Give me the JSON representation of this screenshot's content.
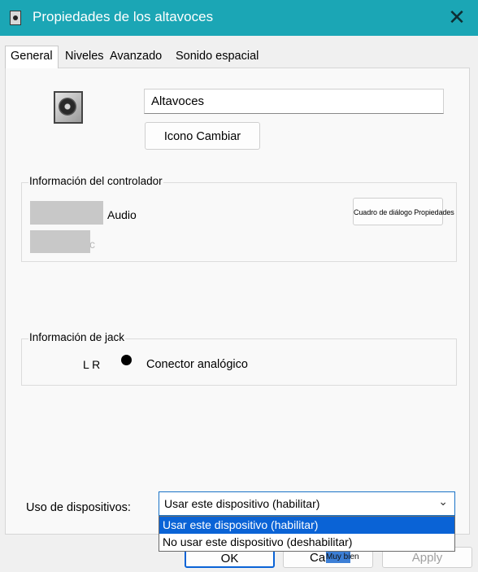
{
  "window": {
    "title": "Propiedades de los altavoces",
    "close_glyph": "✕"
  },
  "tabs": [
    {
      "label": "General",
      "active": true
    },
    {
      "label": "Niveles",
      "active": false
    },
    {
      "label": "Avanzado",
      "active": false
    },
    {
      "label": "Sonido espacial",
      "active": false
    }
  ],
  "general": {
    "device_name": "Altavoces",
    "change_icon_label": "Icono Cambiar",
    "driver_group": {
      "title": "Información del controlador",
      "driver_line1": "Audio",
      "driver_line2_suffix": "c",
      "properties_button": "Cuadro de diálogo Propiedades"
    },
    "jack_group": {
      "title": "Información de jack",
      "channels": "L R",
      "connector": "Conector analógico"
    },
    "usage": {
      "label": "Uso de dispositivos:",
      "selected": "Usar este dispositivo (habilitar)",
      "options": [
        "Usar este dispositivo (habilitar)",
        "No usar este dispositivo (deshabilitar)"
      ]
    }
  },
  "footer": {
    "ok": "OK",
    "cancel": "Ca",
    "cancel_overlay": "Muy bien",
    "apply": "Apply"
  },
  "colors": {
    "titlebar": "#1ba6b5",
    "accent": "#0a63d6"
  }
}
